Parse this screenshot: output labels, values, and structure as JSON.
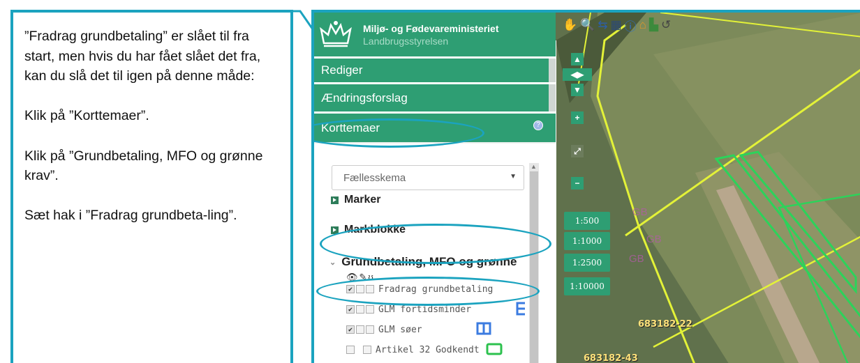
{
  "callout": {
    "p1": "”Fradrag grundbetaling” er slået til fra start, men hvis du har fået slået det fra, kan du slå det til igen på denne måde:",
    "p2": "Klik på ”Korttemaer”.",
    "p3": "Klik på ”Grundbetaling, MFO og grønne krav”.",
    "p4": "Sæt hak i ”Fradrag grundbeta-ling”."
  },
  "header": {
    "title": "Miljø- og Fødevareministeriet",
    "subtitle": "Landbrugsstyrelsen"
  },
  "menu": {
    "rediger": "Rediger",
    "aendringsforslag": "Ændringsforslag",
    "korttemaer": "Korttemaer",
    "help_icon": "help-icon"
  },
  "panel": {
    "select_value": "Fællesskema",
    "themes": [
      "Marker",
      "Markblokke"
    ],
    "group_label": "Grundbetaling, MFO og grønne",
    "layers": [
      {
        "label": "Fradrag grundbetaling",
        "checked": true
      },
      {
        "label": "GLM fortidsminder",
        "checked": true
      },
      {
        "label": "GLM søer",
        "checked": true
      },
      {
        "label": "Artikel 32 Godkendt",
        "checked": false
      }
    ]
  },
  "map": {
    "scales": [
      "1:500",
      "1:1000",
      "1:2500",
      "1:10000"
    ],
    "labels": [
      "683182-22",
      "683182-43"
    ],
    "ghost_labels": [
      "GB",
      "GB",
      "GB"
    ]
  },
  "colors": {
    "accent": "#2e9e73",
    "highlight": "#1ba3bf",
    "map_yellow": "#e3f238",
    "map_green": "#2cd35a"
  }
}
